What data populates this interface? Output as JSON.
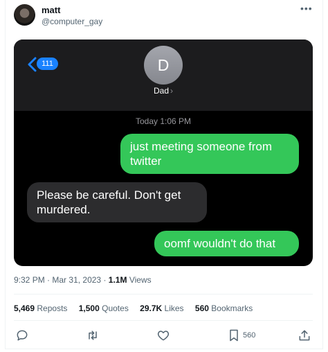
{
  "author": {
    "name": "matt",
    "handle": "@computer_gay",
    "avatar_icon": "profile-photo"
  },
  "more_icon": "more-options-icon",
  "imessage": {
    "back_badge": "111",
    "contact_initial": "D",
    "contact_name": "Dad",
    "contact_chevron": "›",
    "timestamp": "Today 1:06 PM",
    "messages": [
      {
        "direction": "sent",
        "text": "just meeting someone from twitter"
      },
      {
        "direction": "received",
        "text": "Please be careful. Don't get murdered."
      },
      {
        "direction": "sent",
        "text": "oomf wouldn't do that"
      }
    ],
    "colors": {
      "sent": "#34c759",
      "received": "#2c2c2e",
      "badge": "#1a82ff",
      "header": "#1c1c1e"
    }
  },
  "meta": {
    "time": "9:32 PM",
    "separator": "·",
    "date": "Mar 31, 2023",
    "views_count": "1.1M",
    "views_label": "Views"
  },
  "stats": {
    "reposts_count": "5,469",
    "reposts_label": "Reposts",
    "quotes_count": "1,500",
    "quotes_label": "Quotes",
    "likes_count": "29.7K",
    "likes_label": "Likes",
    "bookmarks_count": "560",
    "bookmarks_label": "Bookmarks"
  },
  "actions": {
    "reply_icon": "reply-icon",
    "repost_icon": "repost-icon",
    "like_icon": "heart-icon",
    "bookmark_icon": "bookmark-icon",
    "bookmark_count": "560",
    "share_icon": "share-icon"
  }
}
